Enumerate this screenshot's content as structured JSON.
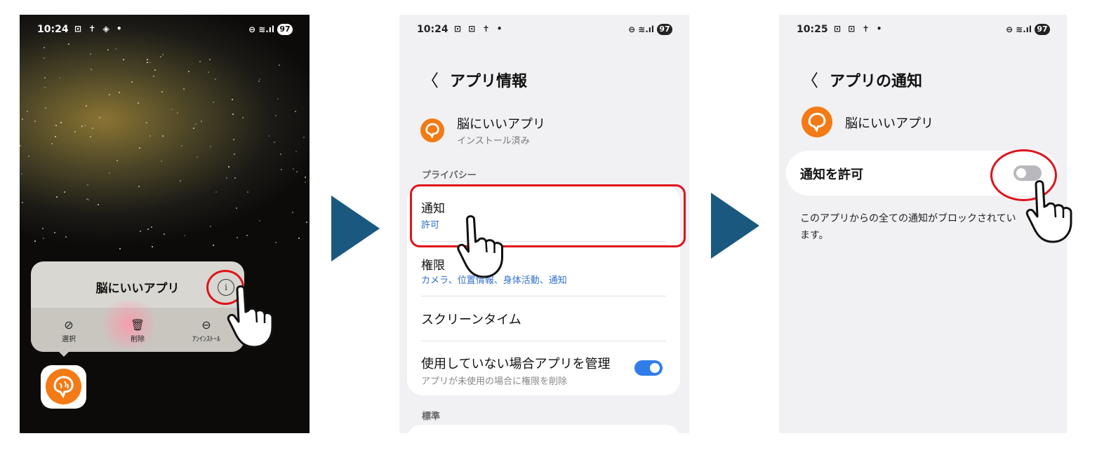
{
  "panel1": {
    "status_time": "10:24",
    "battery": "97",
    "popup_title": "脳にいいアプリ",
    "actions": [
      {
        "label": "選択",
        "icon": "check-circle-icon"
      },
      {
        "label": "削除",
        "icon": "trash-icon"
      },
      {
        "label": "ｱﾝｲﾝｽﾄｰﾙ",
        "icon": "minus-circle-icon"
      }
    ]
  },
  "panel2": {
    "status_time": "10:24",
    "battery": "97",
    "header_title": "アプリ情報",
    "app_name": "脳にいいアプリ",
    "app_status": "インストール済み",
    "section_privacy": "プライバシー",
    "rows": [
      {
        "title": "通知",
        "sub": "許可"
      },
      {
        "title": "権限",
        "sub": "カメラ、位置情報、身体活動、通知"
      },
      {
        "title": "スクリーンタイム",
        "sub": ""
      },
      {
        "title": "使用していない場合アプリを管理",
        "sub": "アプリが未使用の場合に権限を削除"
      }
    ],
    "manage_toggle_on": true,
    "section_standard": "標準"
  },
  "panel3": {
    "status_time": "10:25",
    "battery": "97",
    "header_title": "アプリの通知",
    "app_name": "脳にいいアプリ",
    "allow_label": "通知を許可",
    "allow_toggle_on": false,
    "blocked_text_line1": "このアプリからの全ての通知がブロックされてい",
    "blocked_text_line2": "ます。"
  },
  "colors": {
    "arrow": "#1a5880",
    "highlight": "#e0121b",
    "toggle_on": "#2f7de8",
    "toggle_off": "#b9b9bd",
    "app_orange": "#f37a14"
  }
}
